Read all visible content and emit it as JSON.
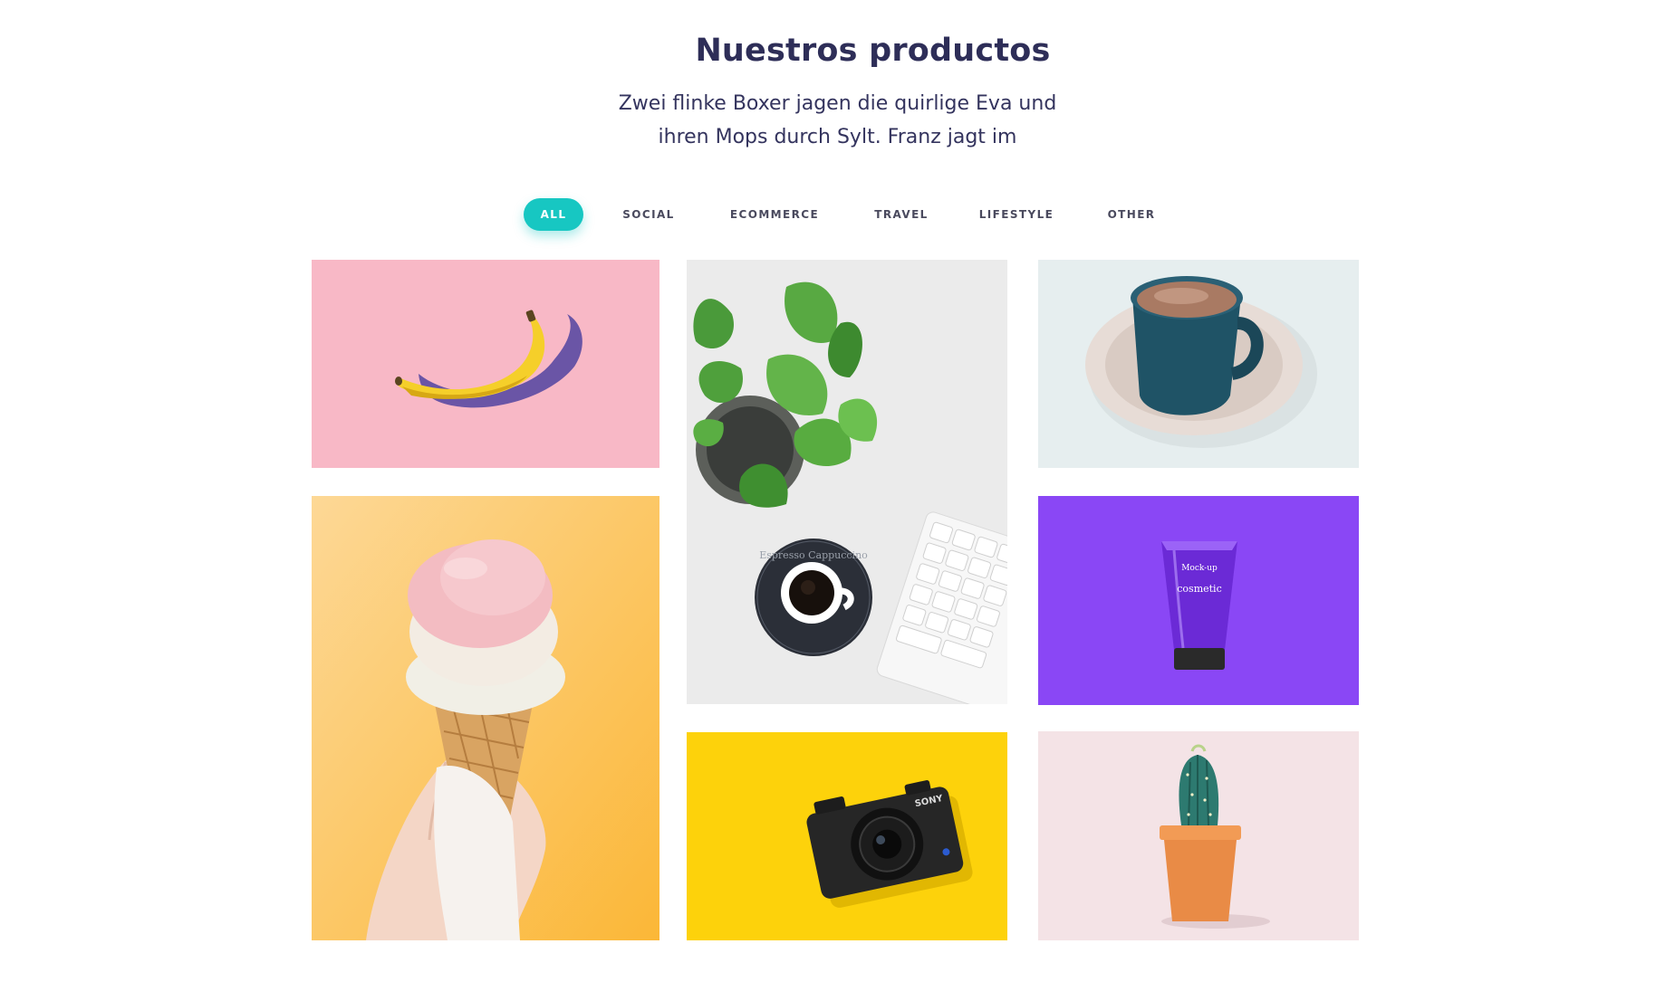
{
  "section": {
    "title": "Nuestros productos",
    "subtitle_line1": "Zwei flinke Boxer jagen die quirlige Eva und",
    "subtitle_line2": "ihren Mops durch Sylt. Franz jagt im"
  },
  "filters": {
    "active": "ALL",
    "items": [
      "ALL",
      "SOCIAL",
      "ECOMMERCE",
      "TRAVEL",
      "LIFESTYLE",
      "OTHER"
    ]
  },
  "gallery": {
    "items": [
      {
        "subject": "banana",
        "bg": "#f8b8c6"
      },
      {
        "subject": "plant-coffee-keyboard",
        "bg": "#eeeeee"
      },
      {
        "subject": "coffee-cup",
        "bg": "#e6eeef"
      },
      {
        "subject": "ice-cream-cone",
        "bg": "#fdc54f"
      },
      {
        "subject": "cosmetic-tube",
        "bg": "#8a47f5"
      },
      {
        "subject": "camera",
        "bg": "#fdd20b"
      },
      {
        "subject": "cactus",
        "bg": "#f4e3e6"
      }
    ],
    "mockup_text": "Mock-up",
    "cosmetic_text": "cosmetic",
    "coaster_text": "Espresso Cappuccino",
    "camera_brand": "SONY"
  },
  "colors": {
    "accent": "#17c7c2",
    "heading": "#2e2e58",
    "filter_text": "#4a4a5e"
  }
}
